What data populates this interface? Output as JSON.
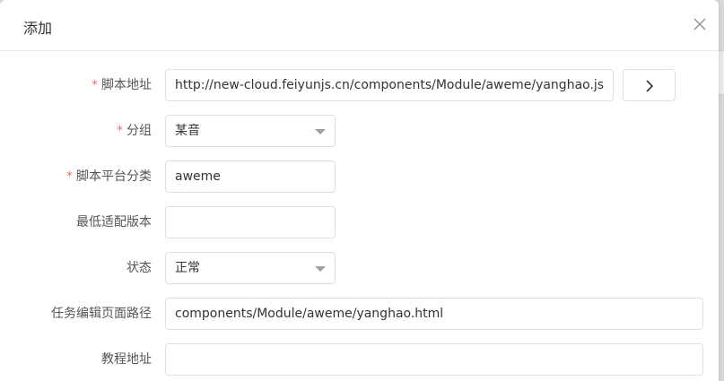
{
  "dialog": {
    "title": "添加"
  },
  "form": {
    "required_mark": "*",
    "script_url": {
      "label": "脚本地址",
      "value": "http://new-cloud.feiyunjs.cn/components/Module/aweme/yanghao.js"
    },
    "group": {
      "label": "分组",
      "value": "某音"
    },
    "platform_category": {
      "label": "脚本平台分类",
      "value": "aweme"
    },
    "min_version": {
      "label": "最低适配版本",
      "value": ""
    },
    "status": {
      "label": "状态",
      "value": "正常"
    },
    "task_edit_path": {
      "label": "任务编辑页面路径",
      "value": "components/Module/aweme/yanghao.html"
    },
    "tutorial_url": {
      "label": "教程地址",
      "value": ""
    }
  },
  "icons": {
    "close": "close-icon",
    "go": "chevron-right-icon",
    "dropdown": "caret-down-icon"
  },
  "colors": {
    "required": "#f56c6c",
    "border": "#dcdfe6"
  }
}
